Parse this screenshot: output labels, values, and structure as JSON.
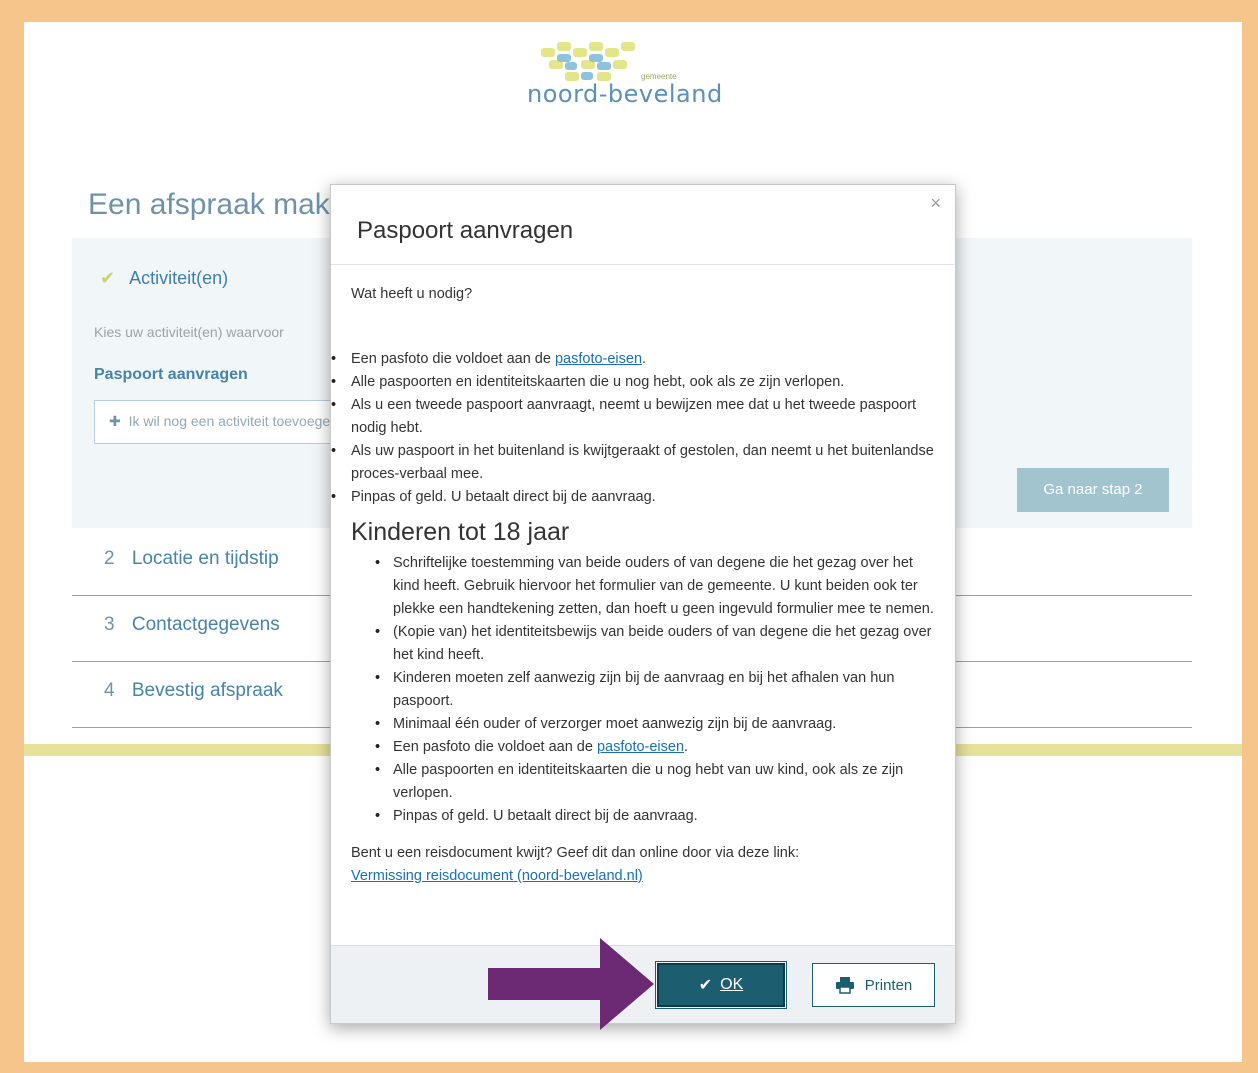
{
  "logo": {
    "text": "noord-beveland",
    "sub": "gemeente"
  },
  "page": {
    "title": "Een afspraak maken"
  },
  "step1": {
    "label": "Activiteit(en)",
    "description": "Kies uw activiteit(en) waarvoor",
    "selected": "Paspoort aanvragen",
    "add_label": "Ik wil nog een activiteit toevoegen",
    "next_label": "Ga naar stap 2"
  },
  "steps": [
    {
      "num": "2",
      "label": "Locatie en tijdstip"
    },
    {
      "num": "3",
      "label": "Contactgegevens"
    },
    {
      "num": "4",
      "label": "Bevestig afspraak"
    }
  ],
  "modal": {
    "title": "Paspoort aanvragen",
    "close": "×",
    "need_heading": "Wat heeft u nodig?",
    "list1": {
      "item1_prefix": "Een pasfoto die voldoet aan de ",
      "item1_link": "pasfoto-eisen",
      "item1_suffix": ".",
      "item2": "Alle paspoorten en identiteitskaarten die u nog hebt, ook als ze zijn verlopen.",
      "item3": "Als u een tweede paspoort aanvraagt, neemt u bewijzen mee dat u het tweede paspoort nodig hebt.",
      "item4": "Als uw paspoort in het buitenland is kwijtgeraakt of gestolen, dan neemt u het buitenlandse proces-verbaal mee.",
      "item5": "Pinpas of geld. U betaalt direct bij de aanvraag."
    },
    "kids_title": "Kinderen tot 18 jaar",
    "list2": {
      "item1": "Schriftelijke toestemming van beide ouders of van degene die het gezag over het kind heeft. Gebruik hiervoor het formulier van de gemeente. U kunt beiden ook ter plekke een handtekening zetten, dan hoeft u geen ingevuld formulier mee te nemen.",
      "item2": "(Kopie van) het identiteitsbewijs van beide ouders of van degene die het gezag over het kind heeft.",
      "item3": "Kinderen moeten zelf aanwezig zijn bij de aanvraag en bij het afhalen van hun paspoort.",
      "item4": "Minimaal één ouder of verzorger moet aanwezig zijn bij de aanvraag.",
      "item5_prefix": "Een pasfoto die voldoet aan de ",
      "item5_link": "pasfoto-eisen",
      "item5_suffix": ".",
      "item6": "Alle paspoorten en identiteitskaarten die u nog hebt van uw kind, ook als ze zijn verlopen.",
      "item7": "Pinpas of geld. U betaalt direct bij de aanvraag."
    },
    "lost_text": "Bent u een reisdocument kwijt? Geef dit dan online door via deze link:",
    "lost_link": "Vermissing reisdocument (noord-beveland.nl)",
    "ok_label": "OK",
    "print_label": "Printen"
  },
  "colors": {
    "accent": "#1d5d70",
    "link": "#1a6fb5",
    "frame": "#f5c58c",
    "annotation_arrow": "#6b2a73"
  }
}
